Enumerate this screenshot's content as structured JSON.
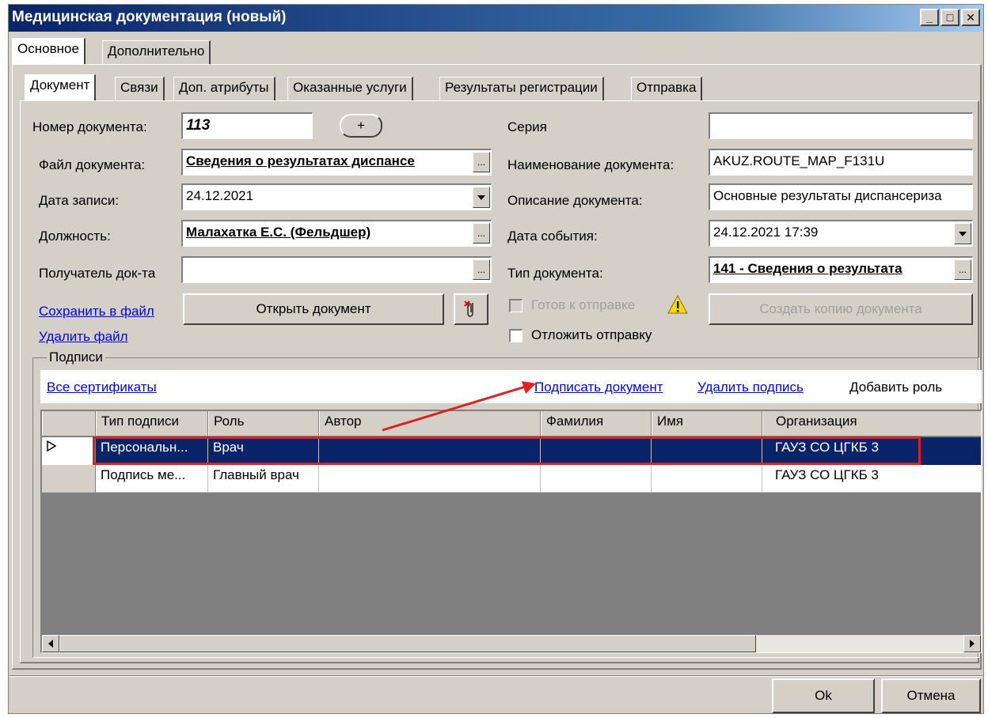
{
  "window": {
    "title": "Медицинская документация (новый)",
    "min_label": "_",
    "max_label": "□",
    "close_label": "✕"
  },
  "outer_tabs": [
    "Основное",
    "Дополнительно"
  ],
  "inner_tabs": [
    "Документ",
    "Связи",
    "Доп. атрибуты",
    "Оказанные услуги",
    "Результаты регистрации",
    "Отправка"
  ],
  "form": {
    "doc_number_label": "Номер документа:",
    "doc_number_value": "113",
    "plus_label": "+",
    "doc_file_label": "Файл документа:",
    "doc_file_value": "Сведения о результатах диспансе",
    "record_date_label": "Дата записи:",
    "record_date_value": "24.12.2021",
    "position_label": "Должность:",
    "position_value": "Малахатка Е.С. (Фельдшер)",
    "recipient_label": "Получатель док-та",
    "recipient_value": "",
    "series_label": "Серия",
    "series_value": "",
    "doc_name_label": "Наименование документа:",
    "doc_name_value": "AKUZ.ROUTE_MAP_F131U",
    "doc_desc_label": "Описание документа:",
    "doc_desc_value": "Основные результаты диспансериза",
    "event_date_label": "Дата события:",
    "event_date_value": "24.12.2021 17:39",
    "doc_type_label": "Тип документа:",
    "doc_type_value": "141 - Сведения о результата",
    "ellipsis": "..."
  },
  "actions": {
    "save_to_file": "Сохранить в файл",
    "delete_file": "Удалить файл",
    "open_document": "Открыть документ",
    "ready_to_send": "Готов к отправке",
    "postpone_send": "Отложить отправку",
    "create_copy": "Создать копию документа"
  },
  "signatures": {
    "group_label": "Подписи",
    "all_certificates": "Все сертификаты",
    "sign_document": "Подписать документ",
    "delete_signature": "Удалить подпись",
    "add_role": "Добавить роль",
    "columns": [
      "Тип подписи",
      "Роль",
      "Автор",
      "Фамилия",
      "Имя",
      "Организация"
    ],
    "rows": [
      {
        "type": "Персональн...",
        "role": "Врач",
        "author": "",
        "surname": "",
        "name": "",
        "org": "ГАУЗ СО ЦГКБ 3",
        "selected": true
      },
      {
        "type": "Подпись ме...",
        "role": "Главный врач",
        "author": "",
        "surname": "",
        "name": "",
        "org": "ГАУЗ СО ЦГКБ 3",
        "selected": false
      }
    ]
  },
  "footer": {
    "ok": "Ok",
    "cancel": "Отмена"
  },
  "colors": {
    "selection": "#0a246a",
    "annotation": "#e02020",
    "link": "#0000ee"
  }
}
